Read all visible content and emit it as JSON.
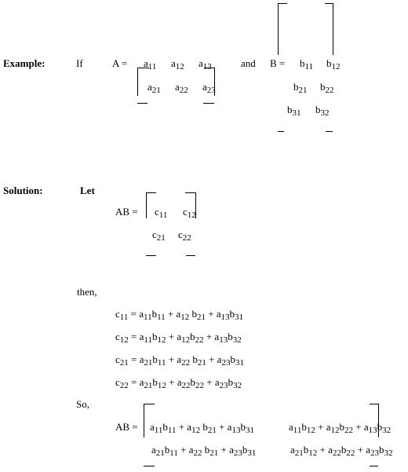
{
  "example": {
    "label": "Example:",
    "if": "If",
    "a_eq": "A =",
    "a_rows": [
      [
        "a11",
        "a12",
        "a13"
      ],
      [
        "a21",
        "a22",
        "a23"
      ]
    ],
    "and": "and",
    "b_eq": "B =",
    "b_rows": [
      [
        "b11",
        "b12"
      ],
      [
        "b21",
        "b22"
      ],
      [
        "b31",
        "b32"
      ]
    ]
  },
  "solution": {
    "label": "Solution:",
    "let": "Let",
    "ab_eq": "AB =",
    "c_rows": [
      [
        "c11",
        "c12"
      ],
      [
        "c21",
        "c22"
      ]
    ],
    "then": "then,",
    "equations": [
      "c11 = a11b11 + a12 b21 + a13b31",
      "c12 = a11b12 + a12b22 + a13b32",
      "c21 = a21b11 + a22 b21 + a23b31",
      "c22 = a21b12 + a22b22 + a23b32"
    ],
    "so": "So,",
    "ab_eq2": "AB =",
    "result_rows": [
      [
        "a11b11 + a12 b21 + a13b31",
        "a11b12 + a12b22 + a13b32"
      ],
      [
        "a21b11 + a22 b21 + a23b31",
        "a21b12 + a22b22 + a23b32"
      ]
    ]
  }
}
